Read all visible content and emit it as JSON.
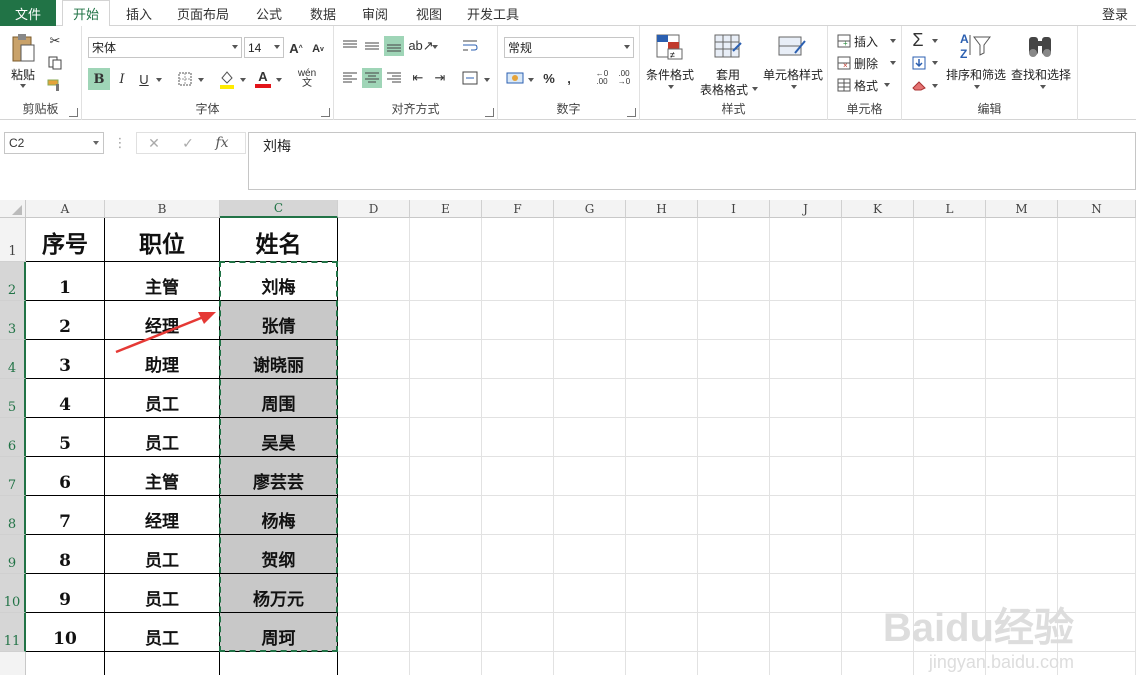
{
  "tabs": {
    "file": "文件",
    "items": [
      "开始",
      "插入",
      "页面布局",
      "公式",
      "数据",
      "审阅",
      "视图",
      "开发工具"
    ],
    "active_index": 0,
    "login": "登录"
  },
  "ribbon": {
    "clipboard": {
      "label": "剪贴板",
      "paste": "粘贴"
    },
    "font": {
      "label": "字体",
      "name": "宋体",
      "size": "14",
      "bold": "B",
      "italic": "I",
      "underline": "U",
      "grow": "A",
      "shrink": "A",
      "color_letter": "A",
      "phonetic": "wén"
    },
    "alignment": {
      "label": "对齐方式"
    },
    "number": {
      "label": "数字",
      "format": "常规",
      "percent": "%",
      "comma": ","
    },
    "styles": {
      "label": "样式",
      "conditional": "条件格式",
      "table_format_1": "套用",
      "table_format_2": "表格格式",
      "cell_styles": "单元格样式"
    },
    "cells": {
      "label": "单元格",
      "insert": "插入",
      "delete": "删除",
      "format": "格式"
    },
    "editing": {
      "label": "编辑",
      "sort_filter": "排序和筛选",
      "find_select": "查找和选择"
    }
  },
  "formula_bar": {
    "name_box": "C2",
    "fx": "fx",
    "value": "刘梅"
  },
  "columns": [
    "A",
    "B",
    "C",
    "D",
    "E",
    "F",
    "G",
    "H",
    "I",
    "J",
    "K",
    "L",
    "M",
    "N"
  ],
  "selected_column": "C",
  "rows": [
    "1",
    "2",
    "3",
    "4",
    "5",
    "6",
    "7",
    "8",
    "9",
    "10",
    "11"
  ],
  "table": {
    "headers": [
      "序号",
      "职位",
      "姓名"
    ],
    "rows": [
      [
        "1",
        "主管",
        "刘梅"
      ],
      [
        "2",
        "经理",
        "张倩"
      ],
      [
        "3",
        "助理",
        "谢晓丽"
      ],
      [
        "4",
        "员工",
        "周围"
      ],
      [
        "5",
        "员工",
        "吴昊"
      ],
      [
        "6",
        "主管",
        "廖芸芸"
      ],
      [
        "7",
        "经理",
        "杨梅"
      ],
      [
        "8",
        "员工",
        "贺纲"
      ],
      [
        "9",
        "员工",
        "杨万元"
      ],
      [
        "10",
        "员工",
        "周珂"
      ]
    ]
  },
  "watermark": {
    "brand": "Baidu经验",
    "url": "jingyan.baidu.com"
  },
  "colors": {
    "accent": "#217346",
    "selection_fill": "#c8c8c8",
    "arrow": "#e53935"
  }
}
